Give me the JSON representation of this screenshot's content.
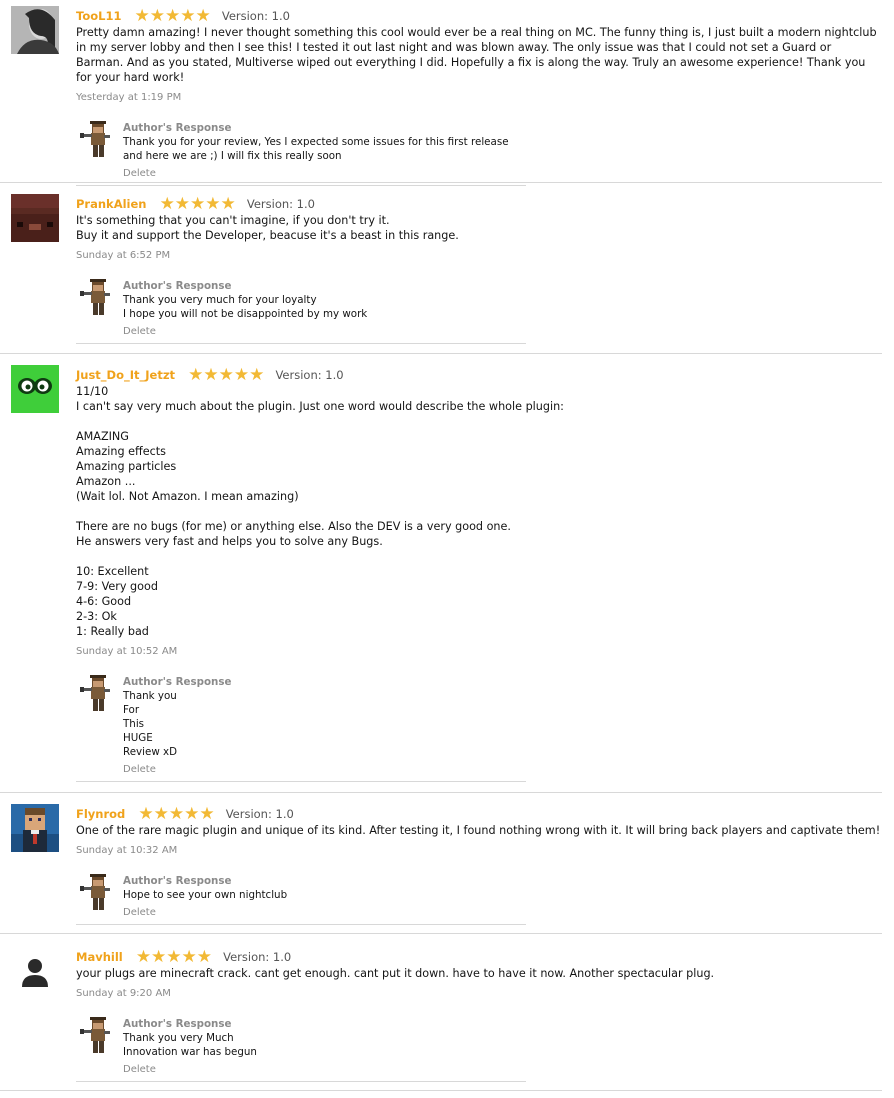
{
  "reviews": [
    {
      "username": "TooL11",
      "stars": "★★★★★",
      "version": "Version: 1.0",
      "body": "Pretty damn amazing! I never thought something this cool would ever be a real thing on MC. The funny thing is, I just built a modern nightclub in my server lobby and then I see this! I tested it out last night and was blown away. The only issue was that I could not set a Guard or Barman. And as you stated, Multiverse wiped out everything I did. Hopefully a fix is along the way. Truly an awesome experience! Thank you for your hard work!",
      "date": "Yesterday at 1:19 PM",
      "response": {
        "title": "Author's Response",
        "text": "Thank you for your review, Yes I expected some issues for this first release and here we are ;) I will fix this really soon",
        "delete": "Delete"
      }
    },
    {
      "username": "PrankAlien",
      "stars": "★★★★★",
      "version": "Version: 1.0",
      "body": "It's something that you can't imagine, if you don't try it.\nBuy it and support the Developer, beacuse it's a beast in this range.",
      "date": "Sunday at 6:52 PM",
      "response": {
        "title": "Author's Response",
        "text": "Thank you very much for your loyalty\nI hope you will not be disappointed by my work",
        "delete": "Delete"
      }
    },
    {
      "username": "Just_Do_It_Jetzt",
      "stars": "★★★★★",
      "version": "Version: 1.0",
      "body": "11/10\nI can't say very much about the plugin. Just one word would describe the whole plugin:\n\nAMAZING\nAmazing effects\nAmazing particles\nAmazon ...\n(Wait lol. Not Amazon. I mean amazing)\n\nThere are no bugs (for me) or anything else. Also the DEV is a very good one.\nHe answers very fast and helps you to solve any Bugs.\n\n10: Excellent\n7-9: Very good\n4-6: Good\n2-3: Ok\n1: Really bad",
      "date": "Sunday at 10:52 AM",
      "response": {
        "title": "Author's Response",
        "text": "Thank you\nFor\nThis\nHUGE\nReview xD",
        "delete": "Delete"
      }
    },
    {
      "username": "Flynrod",
      "stars": "★★★★★",
      "version": "Version: 1.0",
      "body": "One of the rare magic plugin and unique of its kind. After testing it, I found nothing wrong with it. It will bring back players and captivate them!",
      "date": "Sunday at 10:32 AM",
      "response": {
        "title": "Author's Response",
        "text": "Hope to see your own nightclub",
        "delete": "Delete"
      }
    },
    {
      "username": "Mavhill",
      "stars": "★★★★★",
      "version": "Version: 1.0",
      "body": "your plugs are minecraft crack. cant get enough. cant put it down. have to have it now. Another spectacular plug.",
      "date": "Sunday at 9:20 AM",
      "response": {
        "title": "Author's Response",
        "text": "Thank you very Much\nInnovation war has begun",
        "delete": "Delete"
      }
    }
  ],
  "colors": {
    "username": "#f0a21b",
    "stars": "#f2b935",
    "muted": "#8a8a8a",
    "divider": "#d8d8d8"
  },
  "icons": {
    "avatar_0": "user-photo-avatar",
    "avatar_1": "minecraft-head-avatar",
    "avatar_2": "green-eyes-avatar",
    "avatar_3": "minecraft-character-avatar",
    "avatar_4": "default-person-avatar",
    "author_avatar": "gunslinger-avatar"
  }
}
